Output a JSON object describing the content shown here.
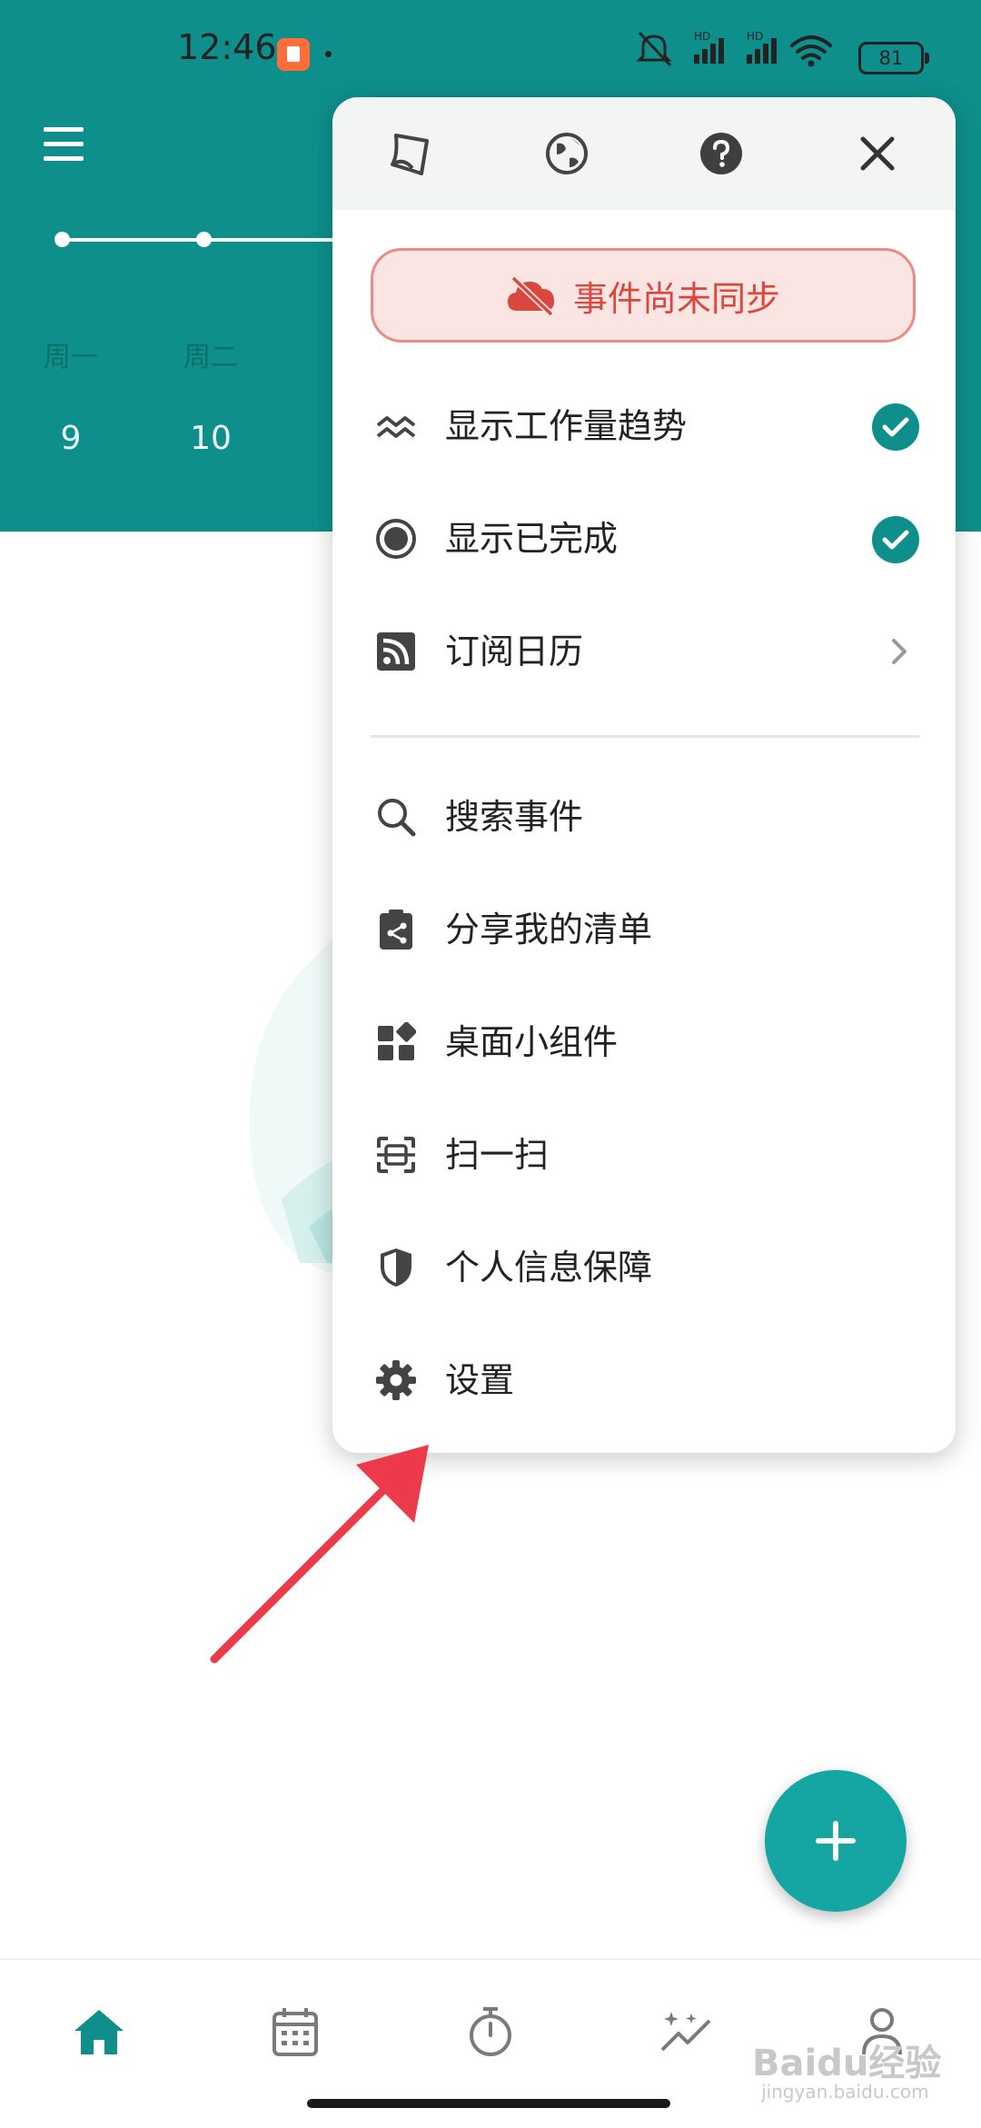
{
  "status_bar": {
    "time": "12:46",
    "battery": "81",
    "network_labels": [
      "HD",
      "HD"
    ]
  },
  "header": {
    "weekdays": [
      "周一",
      "周二"
    ],
    "days": [
      "9",
      "10"
    ]
  },
  "popup": {
    "sync_banner": "事件尚未同步",
    "toggles": [
      {
        "label": "显示工作量趋势",
        "checked": true
      },
      {
        "label": "显示已完成",
        "checked": true
      }
    ],
    "subscribe_label": "订阅日历",
    "actions": [
      "搜索事件",
      "分享我的清单",
      "桌面小组件",
      "扫一扫",
      "个人信息保障",
      "设置"
    ]
  },
  "watermark": {
    "text": "Baidu经验",
    "sub": "jingyan.baidu.com"
  },
  "colors": {
    "brand_teal": "#0e8f8b",
    "fab": "#15a6a4",
    "warning_red": "#d9473e",
    "arrow_red": "#ec3a4a"
  },
  "icons": {
    "top": [
      "skin-icon",
      "globe-icon",
      "help-icon",
      "close-icon"
    ],
    "nav": [
      "home-icon",
      "calendar-icon",
      "timer-icon",
      "stats-icon",
      "profile-icon"
    ]
  }
}
